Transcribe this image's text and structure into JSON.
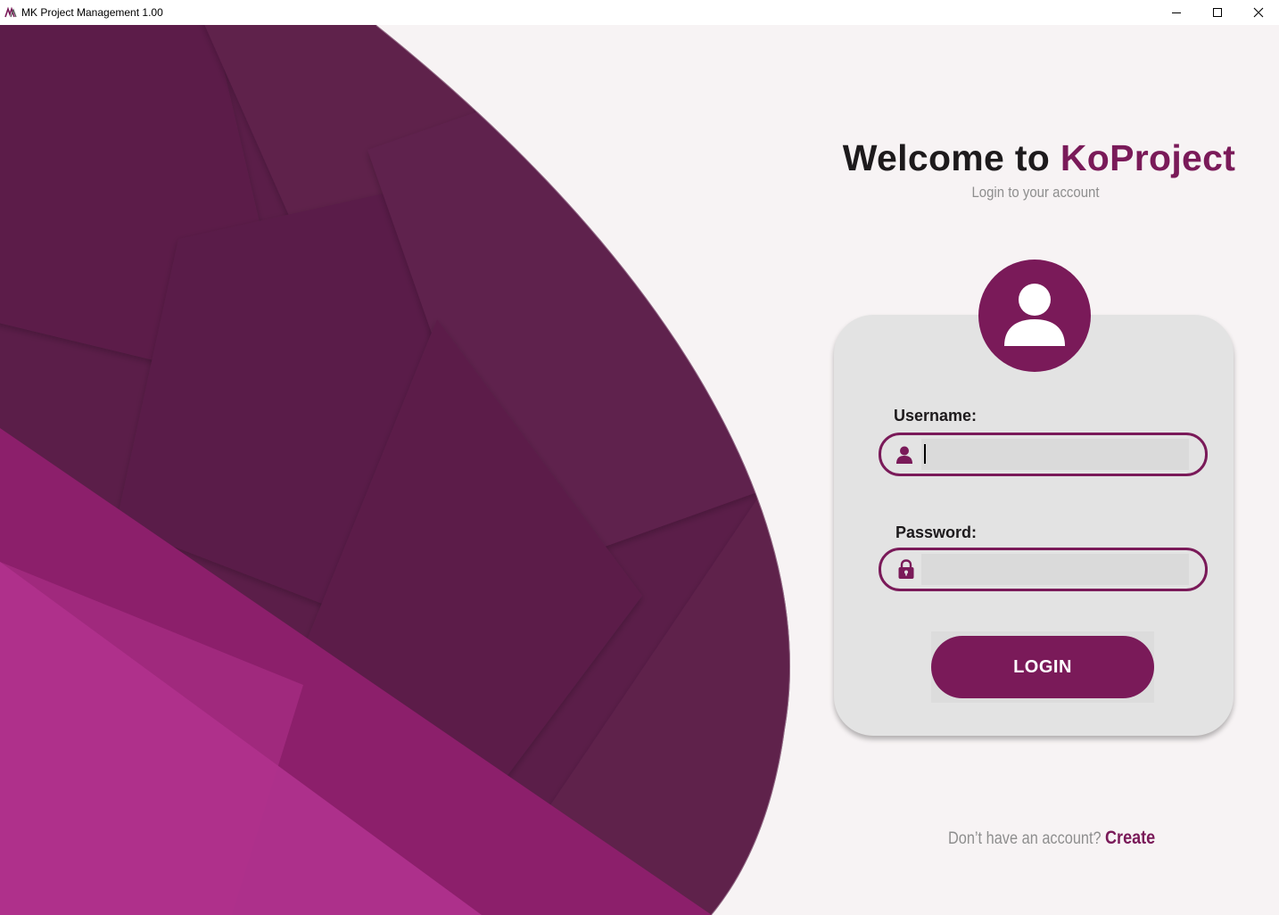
{
  "window": {
    "title": "MK Project Management 1.00"
  },
  "welcome": {
    "prefix": "Welcome to ",
    "brand": "KoProject",
    "subtitle": "Login to your account"
  },
  "form": {
    "username_label": "Username:",
    "username_value": "",
    "password_label": "Password:",
    "password_value": "",
    "login_label": "LOGIN"
  },
  "signup": {
    "question": "Don’t have an account?",
    "link": "Create"
  },
  "colors": {
    "accent": "#7a1a59",
    "dark_plum": "#5d1f4b",
    "magenta": "#8e1f6c",
    "pink": "#b0318c",
    "panel_bg": "#f7f3f4",
    "card_bg": "#e3e3e3"
  },
  "icons": {
    "app": "app-logo-icon",
    "minimize": "minimize-icon",
    "maximize": "maximize-icon",
    "close": "close-icon",
    "avatar": "user-avatar-icon",
    "username": "user-icon",
    "password": "lock-icon"
  }
}
